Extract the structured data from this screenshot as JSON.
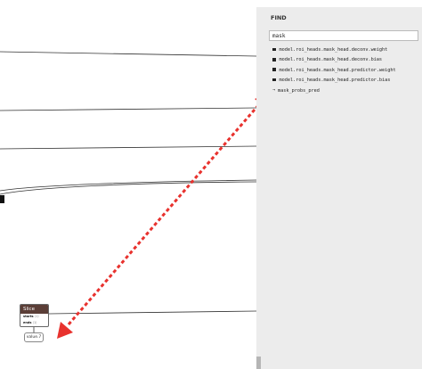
{
  "find_panel": {
    "title": "FIND",
    "search_value": "mask",
    "results": [
      {
        "label": "model.roi_heads.mask_head.deconv.weight",
        "kind": "square"
      },
      {
        "label": "model.roi_heads.mask_head.deconv.bias",
        "kind": "square"
      },
      {
        "label": "model.roi_heads.mask_head.predictor.weight",
        "kind": "square"
      },
      {
        "label": "model.roi_heads.mask_head.predictor.bias",
        "kind": "square"
      },
      {
        "label": "mask_probs_pred",
        "kind": "arrow"
      }
    ]
  },
  "graph": {
    "slice_node": {
      "title": "Slice",
      "attrs": [
        {
          "name": "starts",
          "value": "⟨1⟩"
        },
        {
          "name": "ends",
          "value": "⟨1⟩"
        }
      ]
    },
    "value_node": {
      "label": "value.7"
    }
  },
  "annotation": {
    "arrow_color": "#e8322e"
  }
}
